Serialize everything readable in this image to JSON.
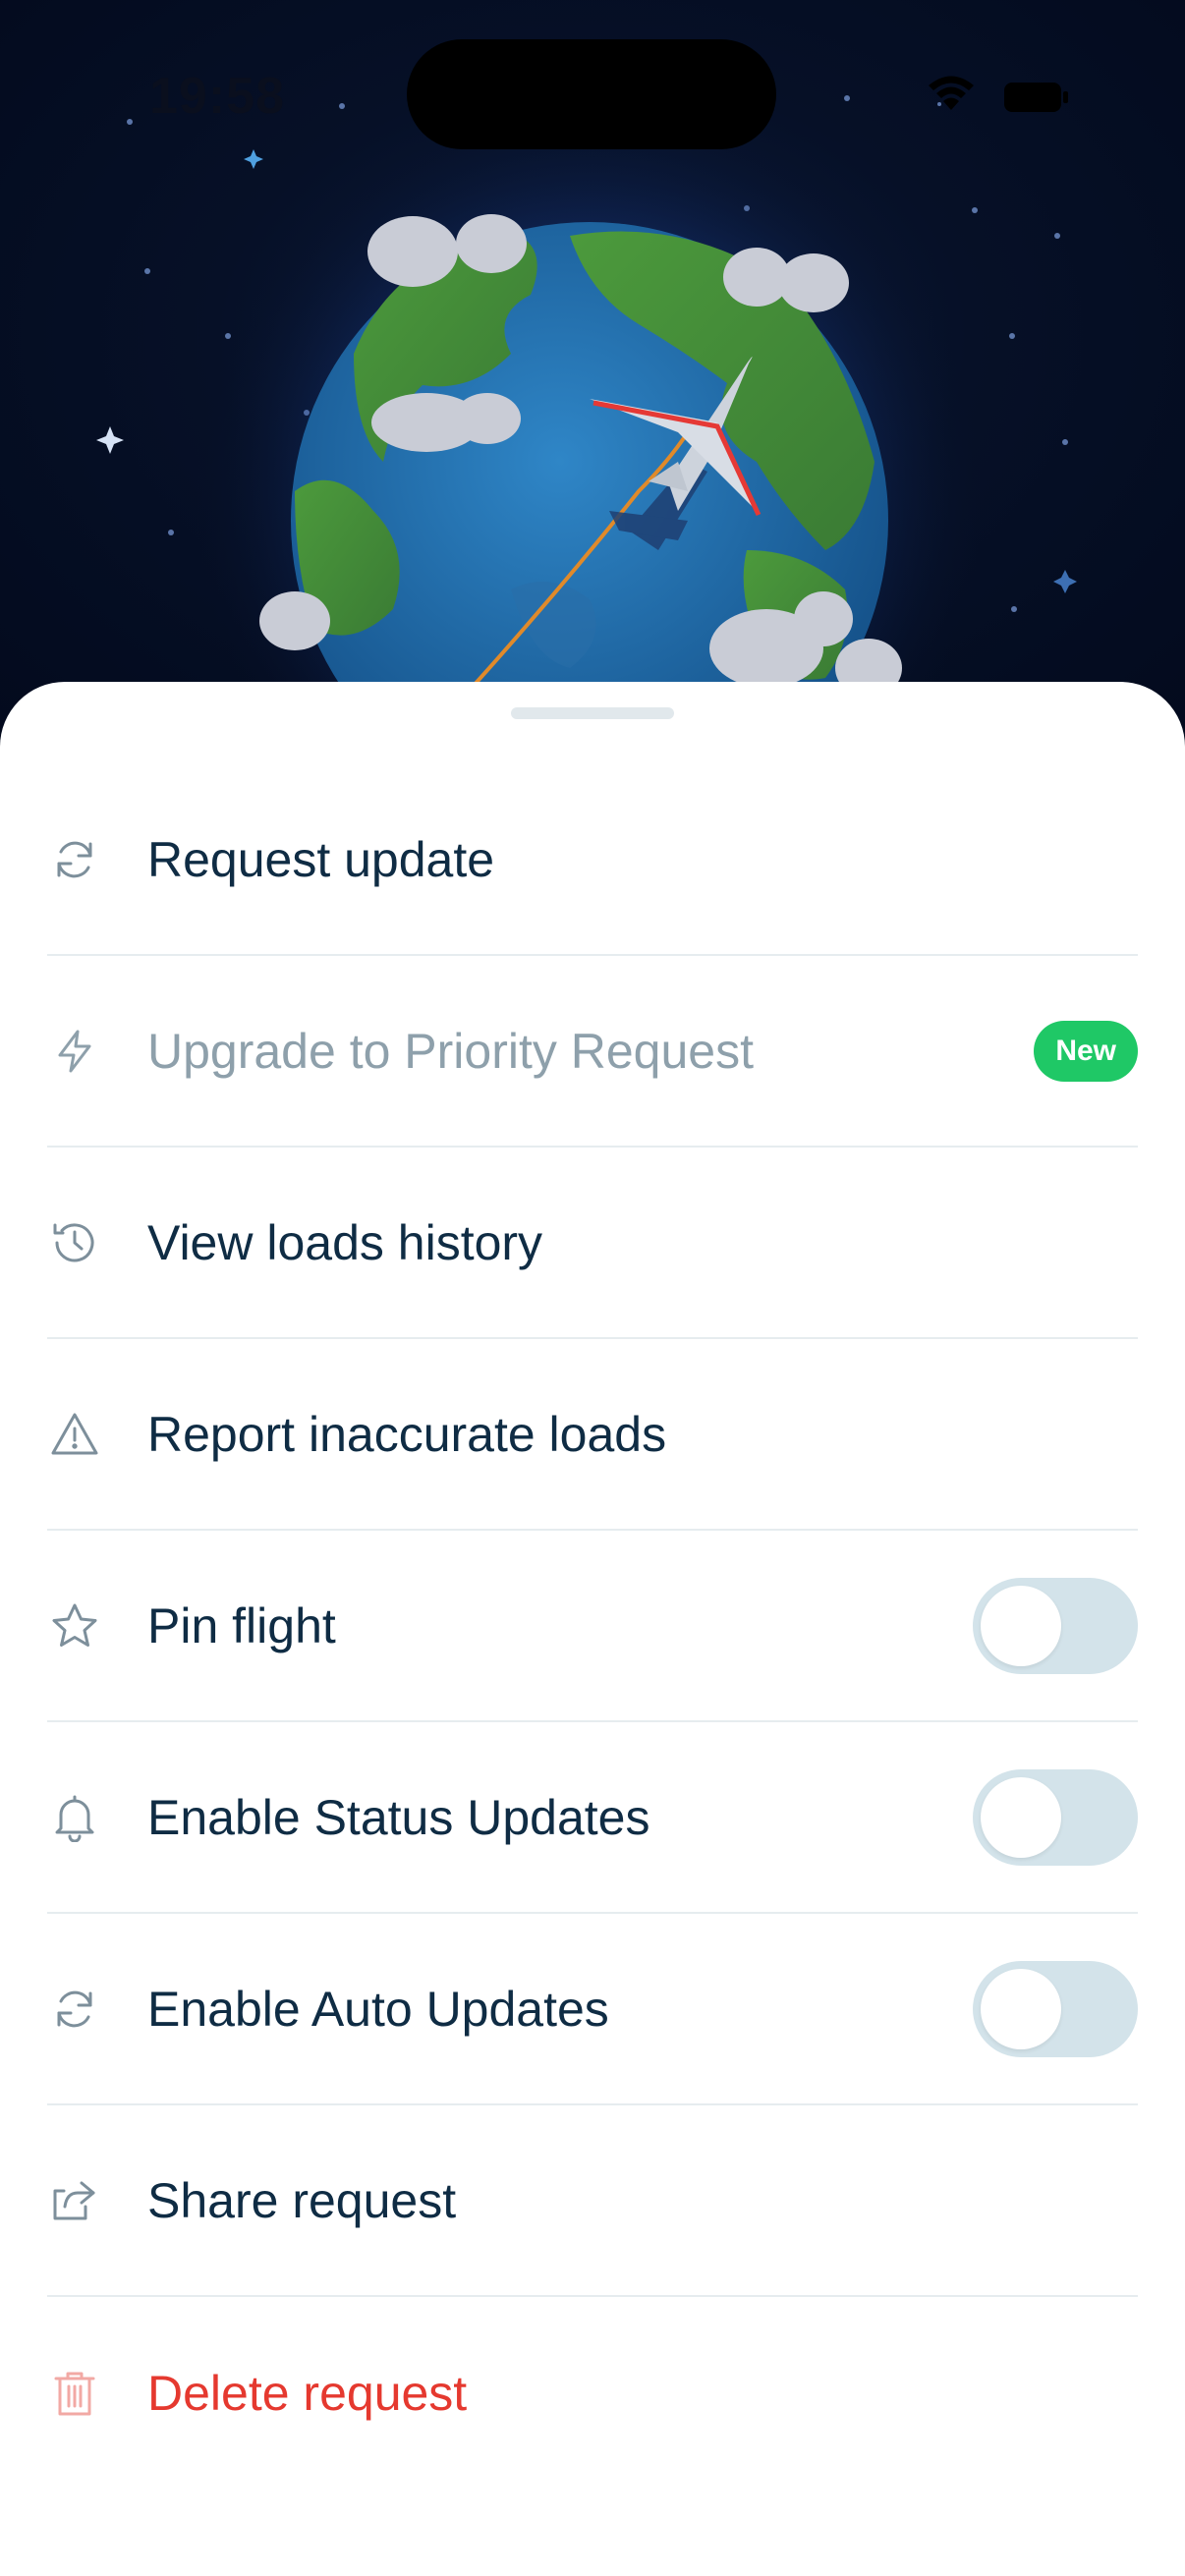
{
  "status_bar": {
    "time": "19:58",
    "wifi_icon": "wifi-icon",
    "battery_icon": "battery-icon"
  },
  "hero": {
    "illustration": "globe-with-airplane",
    "colors": {
      "sky": "#050b1e",
      "ocean": "#1e6aa7",
      "land": "#3f8a3a",
      "plane_stripe": "#e53935"
    }
  },
  "sheet": {
    "items": [
      {
        "label": "Request update",
        "icon": "refresh-icon",
        "state": "enabled"
      },
      {
        "label": "Upgrade to Priority Request",
        "icon": "lightning-icon",
        "state": "disabled",
        "badge": "New"
      },
      {
        "label": "View loads history",
        "icon": "history-icon",
        "state": "enabled"
      },
      {
        "label": "Report inaccurate loads",
        "icon": "warning-icon",
        "state": "enabled"
      },
      {
        "label": "Pin flight",
        "icon": "star-icon",
        "state": "enabled",
        "toggle": false
      },
      {
        "label": "Enable Status Updates",
        "icon": "bell-icon",
        "state": "enabled",
        "toggle": false
      },
      {
        "label": "Enable Auto Updates",
        "icon": "refresh-icon",
        "state": "enabled",
        "toggle": false
      },
      {
        "label": "Share request",
        "icon": "share-icon",
        "state": "enabled"
      },
      {
        "label": "Delete request",
        "icon": "trash-icon",
        "state": "danger"
      }
    ],
    "colors": {
      "text": "#0f2c44",
      "disabled_text": "#8ea0ab",
      "danger": "#e5392f",
      "badge": "#1fc866",
      "toggle_off": "#d3e3ea"
    }
  }
}
